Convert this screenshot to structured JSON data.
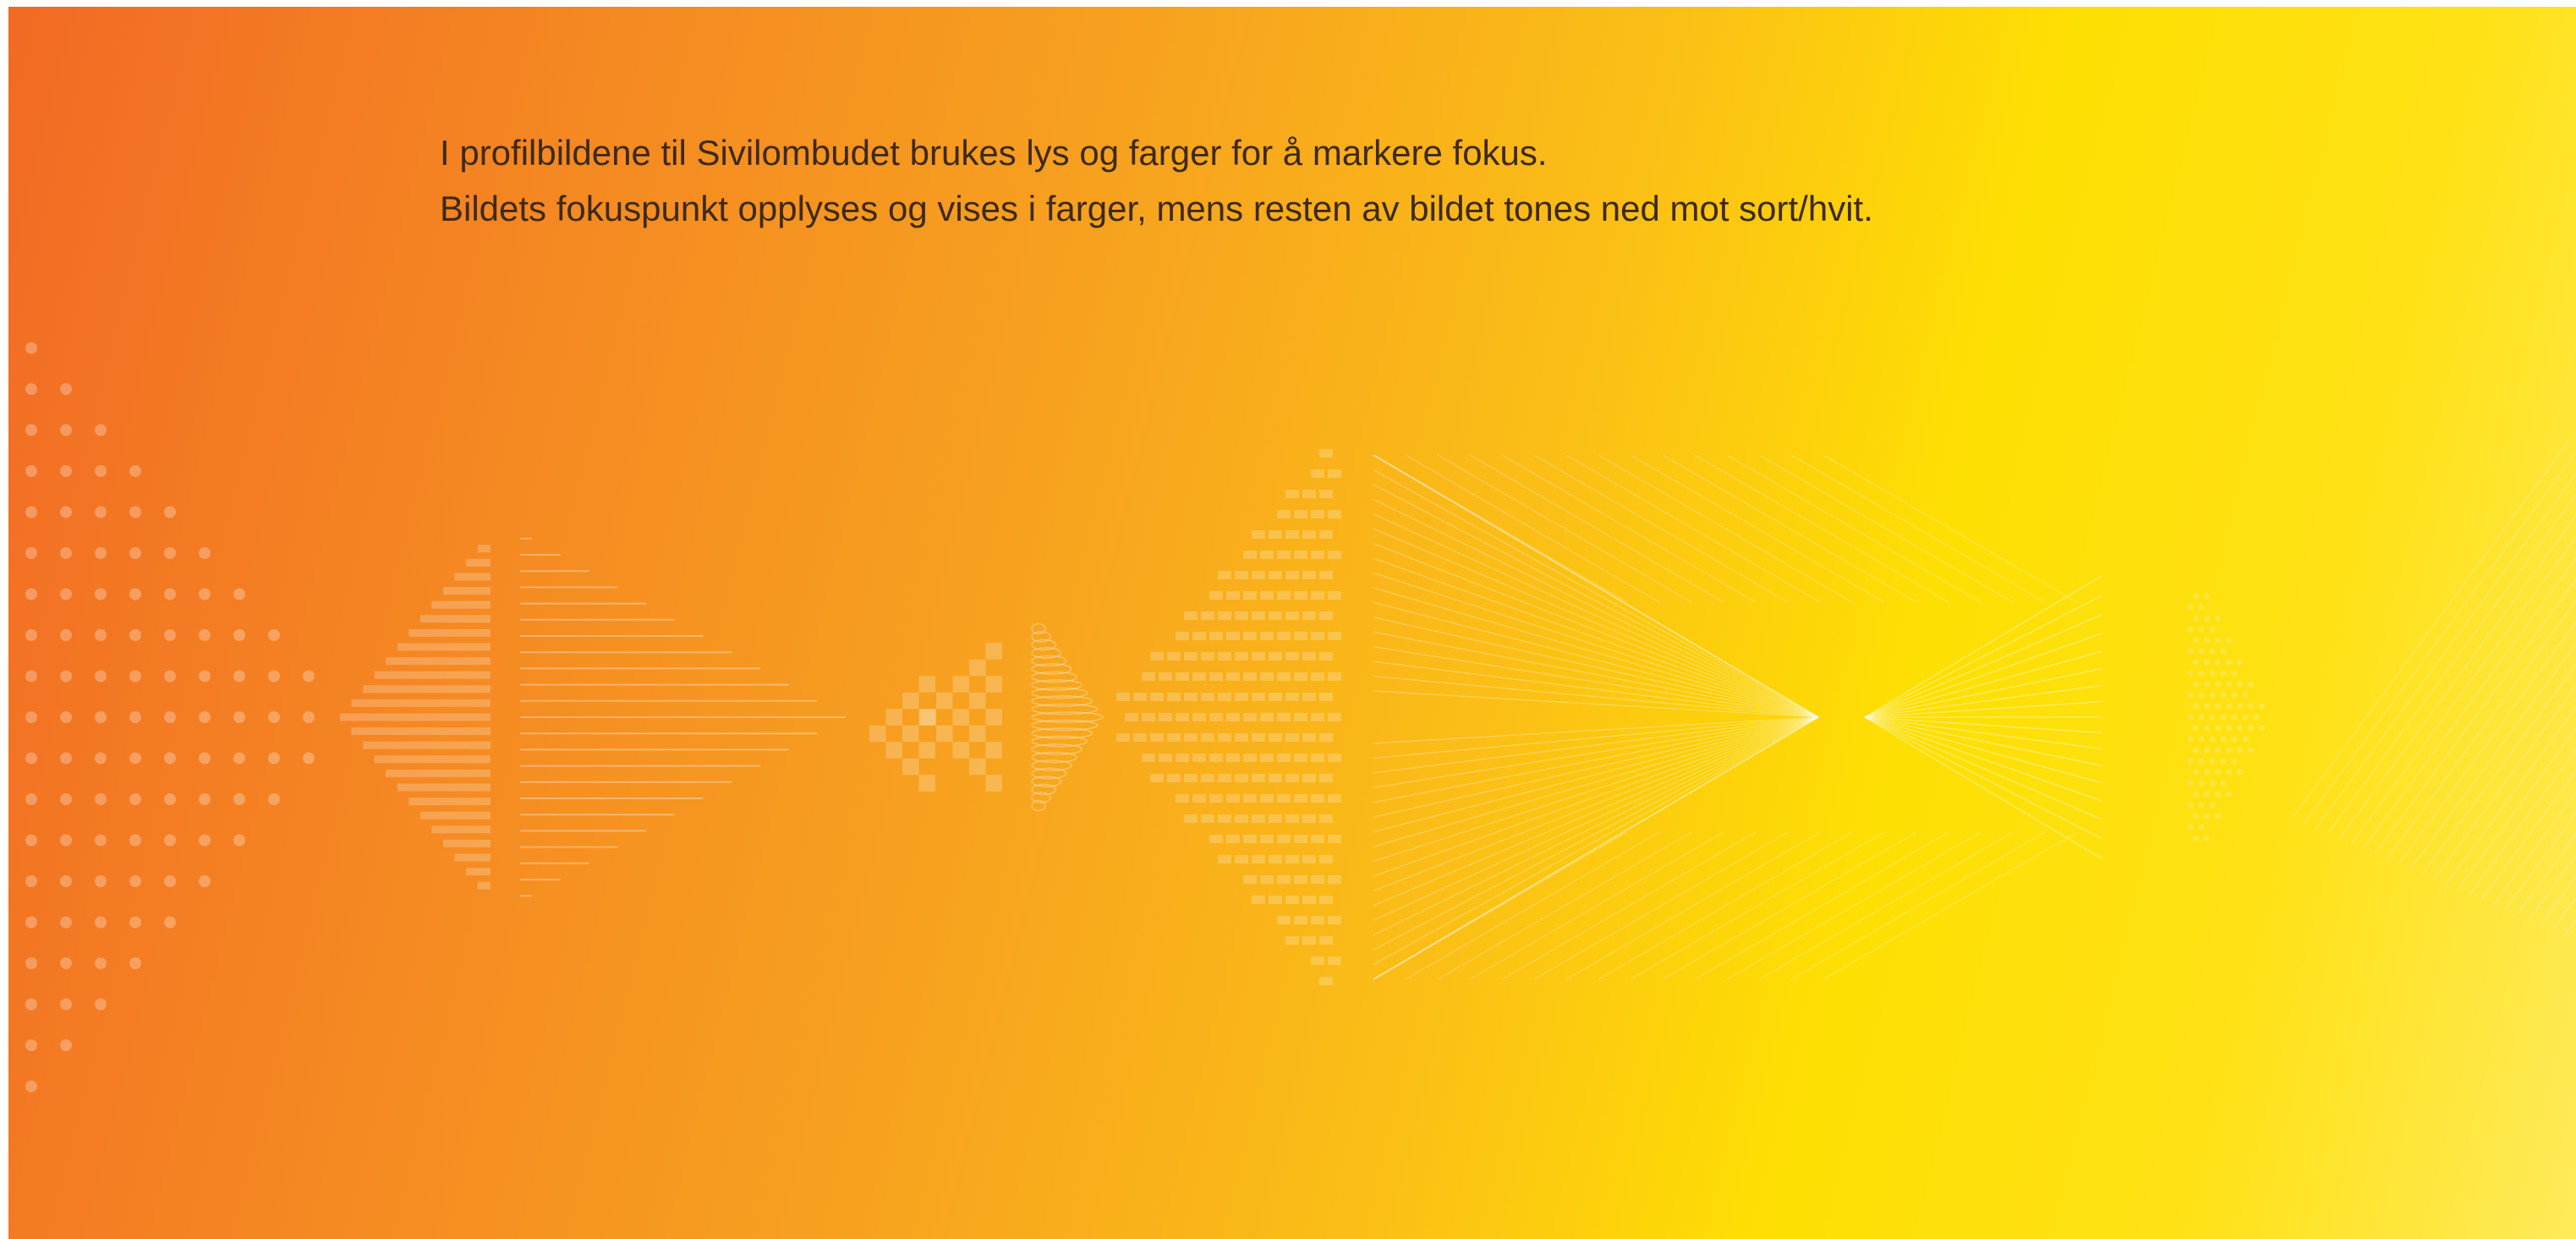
{
  "caption": {
    "line1": "I profilbildene til Sivilombudet brukes lys og farger for å markere fokus.",
    "line2": "Bildets fokuspunkt opplyses og vises i farger, mens resten av bildet tones ned mot sort/hvit."
  },
  "colors": {
    "gradient_start": "#f26a24",
    "gradient_mid": "#fbbf16",
    "gradient_end": "#ffea5a",
    "text": "#3d2a19",
    "pattern": "#ffffff"
  },
  "patterns": [
    "dot-triangle",
    "striped-diamond",
    "lines-triangle",
    "checker-diamond",
    "ellipse-stack",
    "dash-triangle",
    "mesh-chevron",
    "ray-fan",
    "small-dot-diamond",
    "diagonal-lines"
  ]
}
